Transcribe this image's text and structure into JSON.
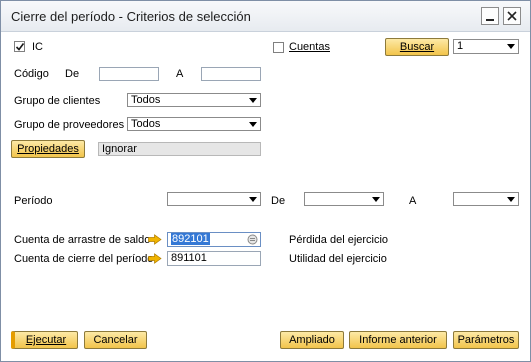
{
  "window": {
    "title": "Cierre del período - Criterios de selección"
  },
  "top": {
    "ic_label": "IC",
    "ic_checked": true,
    "cuentas_label": "Cuentas",
    "cuentas_checked": false,
    "buscar_label": "Buscar",
    "buscar_value": "1"
  },
  "codigo": {
    "label": "Código",
    "from_label": "De",
    "to_label": "A",
    "from_value": "",
    "to_value": ""
  },
  "grupo_clientes": {
    "label": "Grupo de clientes",
    "value": "Todos"
  },
  "grupo_proveedores": {
    "label": "Grupo de proveedores",
    "value": "Todos"
  },
  "propiedades": {
    "button_label": "Propiedades",
    "value": "Ignorar"
  },
  "periodo": {
    "label": "Período",
    "from_label": "De",
    "to_label": "A",
    "period_value": "",
    "from_value": "",
    "to_value": ""
  },
  "cuenta_arrastre": {
    "label": "Cuenta de arrastre de saldo",
    "value": "892101",
    "description": "Pérdida del ejercicio"
  },
  "cuenta_cierre": {
    "label": "Cuenta de cierre del período",
    "value": "891101",
    "description": "Utilidad del ejercicio"
  },
  "footer": {
    "ejecutar": "Ejecutar",
    "cancelar": "Cancelar",
    "ampliado": "Ampliado",
    "informe_anterior": "Informe anterior",
    "parametros": "Parámetros"
  },
  "colors": {
    "gold_button": "#f2c44b",
    "arrow_icon": "#f0b400",
    "selection": "#3478d5"
  }
}
